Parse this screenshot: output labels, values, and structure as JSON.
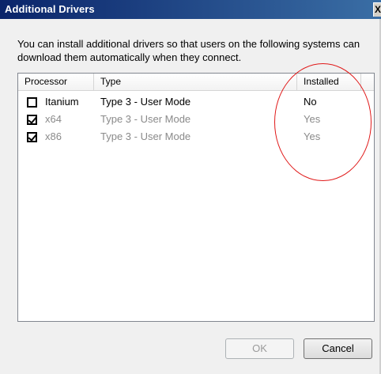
{
  "window": {
    "title": "Additional Drivers",
    "close_glyph": "X"
  },
  "description": "You can install additional drivers so that users on the following systems can download them automatically when they connect.",
  "table": {
    "columns": [
      "Processor",
      "Type",
      "Installed"
    ],
    "rows": [
      {
        "processor": "Itanium",
        "type": "Type 3 - User Mode",
        "installed": "No",
        "checked": false,
        "dimmed": false
      },
      {
        "processor": "x64",
        "type": "Type 3 - User Mode",
        "installed": "Yes",
        "checked": true,
        "dimmed": true
      },
      {
        "processor": "x86",
        "type": "Type 3 - User Mode",
        "installed": "Yes",
        "checked": true,
        "dimmed": true
      }
    ]
  },
  "buttons": {
    "ok_label": "OK",
    "cancel_label": "Cancel"
  },
  "colors": {
    "annotation": "#e01818",
    "titlebar": "#0a246a"
  }
}
